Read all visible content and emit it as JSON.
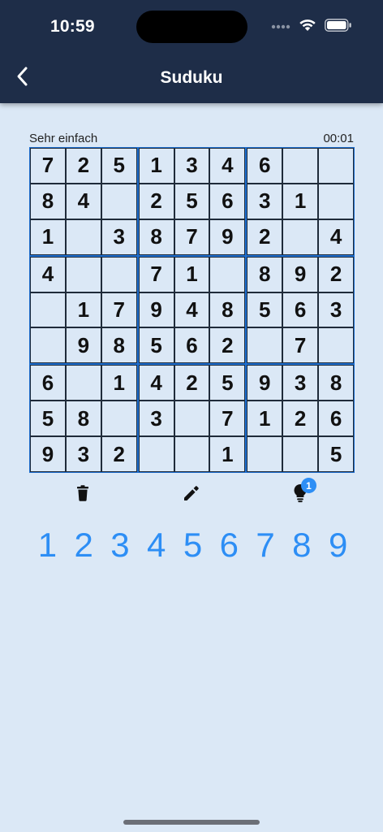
{
  "status": {
    "time": "10:59"
  },
  "nav": {
    "title": "Suduku"
  },
  "game": {
    "difficulty": "Sehr einfach",
    "timer": "00:01",
    "grid": [
      [
        "7",
        "2",
        "5",
        "1",
        "3",
        "4",
        "6",
        "",
        ""
      ],
      [
        "8",
        "4",
        "",
        "2",
        "5",
        "6",
        "3",
        "1",
        ""
      ],
      [
        "1",
        "",
        "3",
        "8",
        "7",
        "9",
        "2",
        "",
        "4"
      ],
      [
        "4",
        "",
        "",
        "7",
        "1",
        "",
        "8",
        "9",
        "2"
      ],
      [
        "",
        "1",
        "7",
        "9",
        "4",
        "8",
        "5",
        "6",
        "3"
      ],
      [
        "",
        "9",
        "8",
        "5",
        "6",
        "2",
        "",
        "7",
        ""
      ],
      [
        "6",
        "",
        "1",
        "4",
        "2",
        "5",
        "9",
        "3",
        "8"
      ],
      [
        "5",
        "8",
        "",
        "3",
        "",
        "7",
        "1",
        "2",
        "6"
      ],
      [
        "9",
        "3",
        "2",
        "",
        "",
        "1",
        "",
        "",
        "5"
      ]
    ]
  },
  "actions": {
    "hint_count": "1"
  },
  "numpad": [
    "1",
    "2",
    "3",
    "4",
    "5",
    "6",
    "7",
    "8",
    "9"
  ],
  "colors": {
    "background": "#dbe8f6",
    "header": "#1e2d48",
    "accent": "#2d8ef5",
    "box_border": "#1e6fd0"
  },
  "icons": [
    "back-chevron-icon",
    "signal-dots-icon",
    "wifi-icon",
    "battery-icon",
    "delete-icon",
    "pencil-icon",
    "hint-bulb-icon"
  ]
}
